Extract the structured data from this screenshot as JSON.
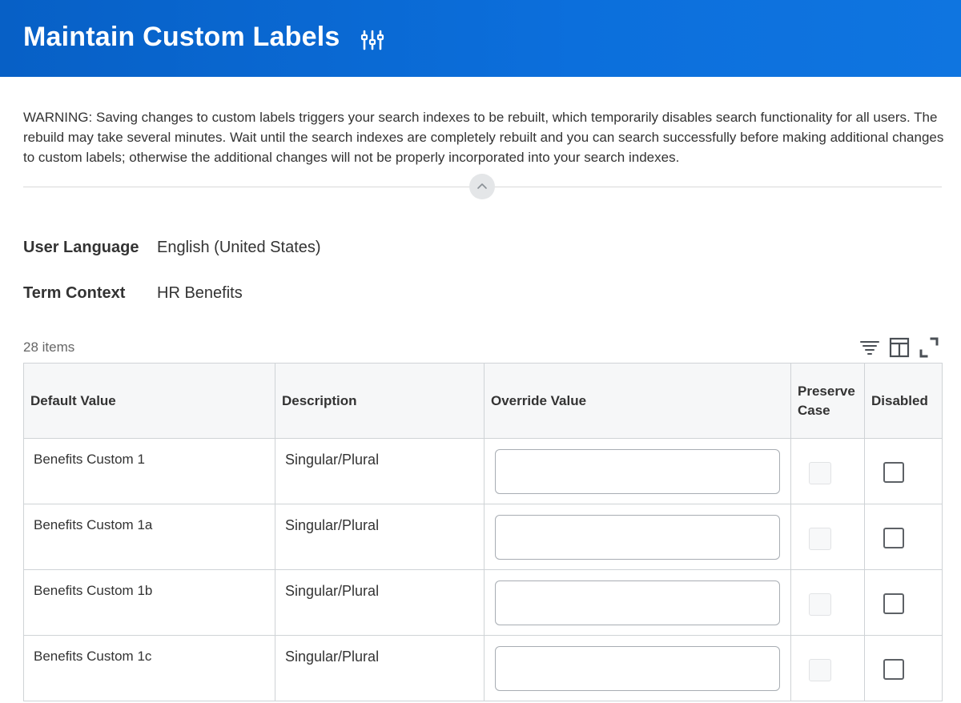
{
  "page": {
    "title": "Maintain Custom Labels",
    "related_actions_icon": "related-actions-icon",
    "warning": "WARNING: Saving changes to custom labels triggers your search indexes to be rebuilt, which temporarily disables search functionality for all users. The rebuild may take several minutes. Wait until the search indexes are completely rebuilt and you can search successfully before making additional changes to custom labels; otherwise the additional changes will not be properly incorporated into your search indexes.",
    "header_color": "#0a6ad6"
  },
  "fields": {
    "user_language": {
      "label": "User Language",
      "value": "English (United States)"
    },
    "term_context": {
      "label": "Term Context",
      "value": "HR Benefits"
    }
  },
  "grid": {
    "count": "28 items",
    "toolbar_icons": [
      "filter-icon",
      "column-chooser-icon",
      "fullscreen-icon"
    ],
    "columns": {
      "default_value": "Default Value",
      "description": "Description",
      "override_value": "Override Value",
      "preserve_case_line1": "Preserve",
      "preserve_case_line2": "Case",
      "disabled": "Disabled"
    },
    "rows": [
      {
        "default_value": "Benefits Custom 1",
        "description": "Singular/Plural",
        "override_value": ""
      },
      {
        "default_value": "Benefits Custom 1a",
        "description": "Singular/Plural",
        "override_value": ""
      },
      {
        "default_value": "Benefits Custom 1b",
        "description": "Singular/Plural",
        "override_value": ""
      },
      {
        "default_value": "Benefits Custom 1c",
        "description": "Singular/Plural",
        "override_value": ""
      }
    ]
  }
}
